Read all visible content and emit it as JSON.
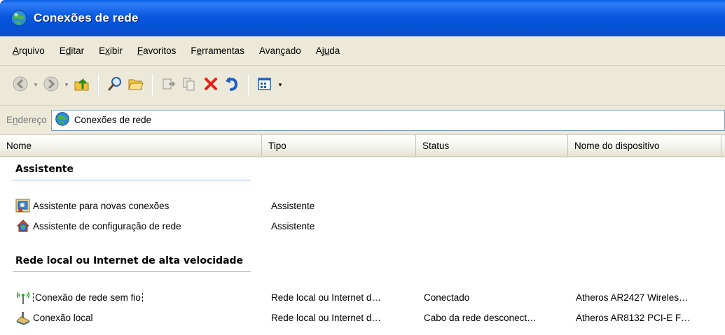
{
  "window": {
    "title": "Conexões de rede",
    "title_icon": "network-connections-icon"
  },
  "menu": [
    {
      "pre": "",
      "u": "A",
      "post": "rquivo"
    },
    {
      "pre": "E",
      "u": "d",
      "post": "itar"
    },
    {
      "pre": "E",
      "u": "x",
      "post": "ibir"
    },
    {
      "pre": "",
      "u": "F",
      "post": "avoritos"
    },
    {
      "pre": "F",
      "u": "e",
      "post": "rramentas"
    },
    {
      "pre": "Avan",
      "u": "ç",
      "post": "ado"
    },
    {
      "pre": "Aj",
      "u": "u",
      "post": "da"
    }
  ],
  "toolbar": {
    "back": "back-arrow-icon",
    "forward": "forward-arrow-icon",
    "up": "folder-up-icon",
    "search": "search-icon",
    "folders": "folders-icon",
    "move": "move-to-icon",
    "copy": "copy-to-icon",
    "delete": "delete-icon",
    "undo": "undo-icon",
    "views": "views-icon"
  },
  "address": {
    "label_pre": "E",
    "label_u": "n",
    "label_post": "dereço",
    "value": "Conexões de rede"
  },
  "columns": {
    "nome": "Nome",
    "tipo": "Tipo",
    "status": "Status",
    "dispositivo": "Nome do dispositivo"
  },
  "groups": [
    {
      "title": "Assistente",
      "items": [
        {
          "icon": "new-connection-wizard-icon",
          "nome": "Assistente para novas conexões",
          "tipo": "Assistente",
          "status": "",
          "dispositivo": ""
        },
        {
          "icon": "network-setup-wizard-icon",
          "nome": "Assistente de configuração de rede",
          "tipo": "Assistente",
          "status": "",
          "dispositivo": ""
        }
      ]
    },
    {
      "title": "Rede local ou Internet de alta velocidade",
      "items": [
        {
          "icon": "wireless-network-icon",
          "nome": "Conexão de rede sem fio",
          "tipo": "Rede local ou Internet d…",
          "status": "Conectado",
          "dispositivo": "Atheros AR2427 Wireles…"
        },
        {
          "icon": "local-area-connection-icon",
          "nome": "Conexão local",
          "tipo": "Rede local ou Internet d…",
          "status": "Cabo da rede desconect…",
          "dispositivo": "Atheros AR8132 PCI-E F…"
        }
      ]
    }
  ]
}
